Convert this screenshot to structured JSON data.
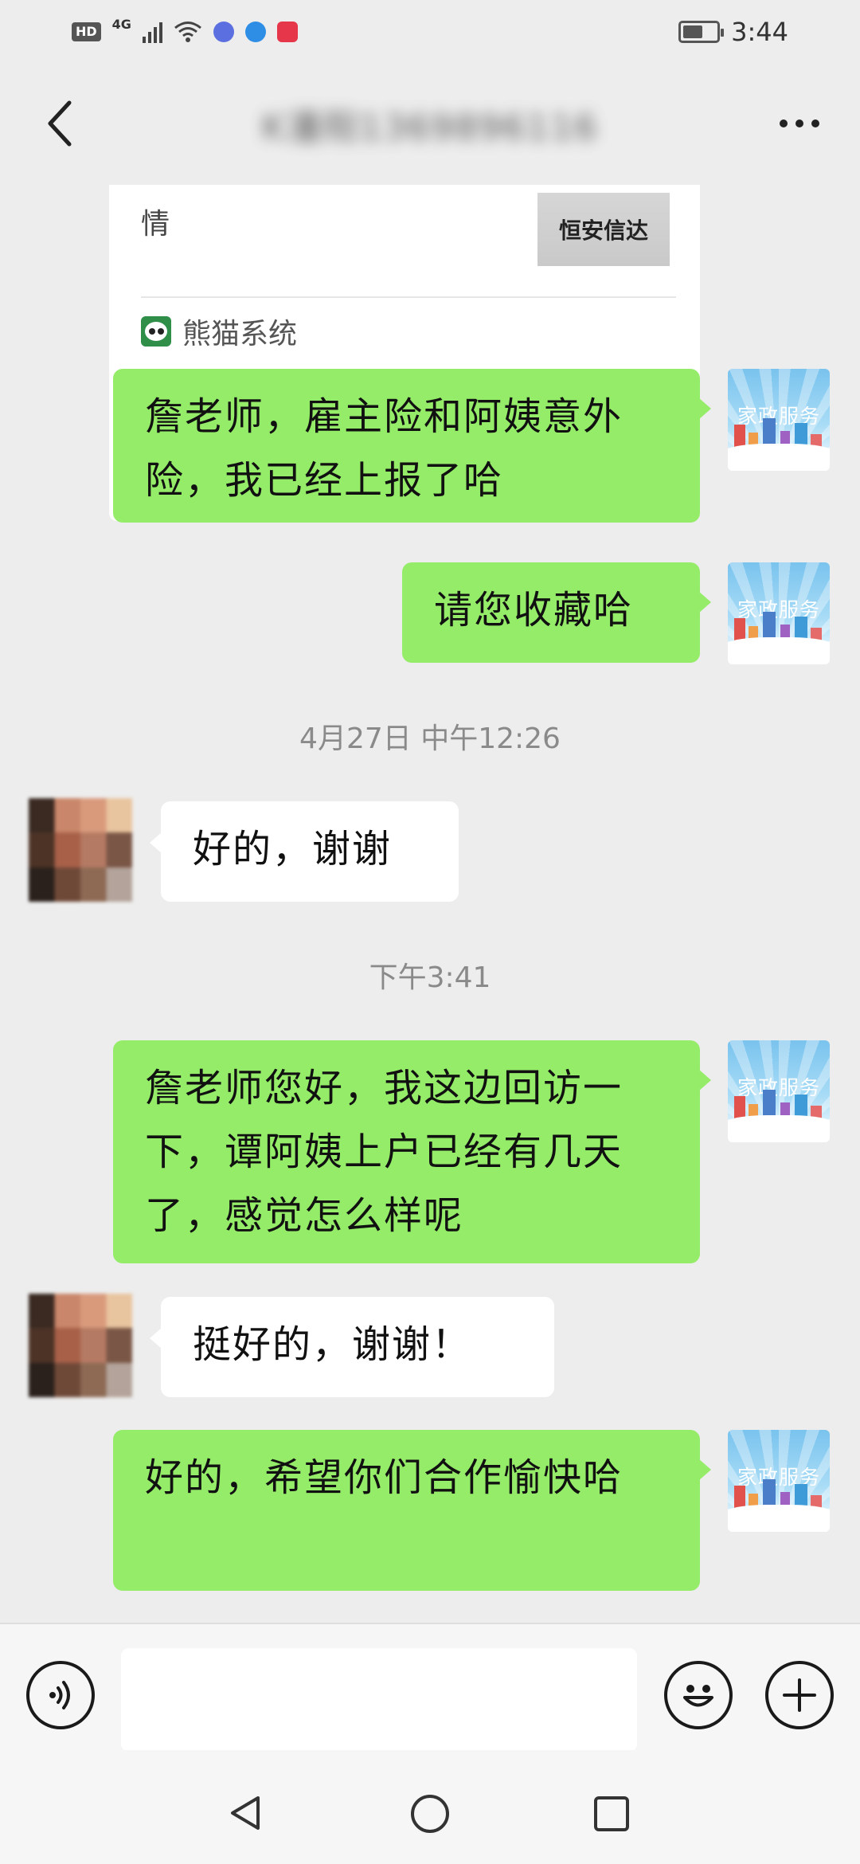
{
  "status_bar": {
    "hd": "HD",
    "network": "4G",
    "time": "3:44",
    "battery_level": 0.6
  },
  "header": {
    "title": "K潘阳1369896116"
  },
  "card": {
    "title": "情",
    "thumb_text": "恒安信达",
    "source": "熊猫系统"
  },
  "messages": {
    "m1": "詹老师，雇主险和阿姨意外险，我已经上报了哈",
    "m2": "请您收藏哈",
    "time1": "4月27日 中午12:26",
    "m3": "好的，谢谢",
    "time2": "下午3:41",
    "m4": "詹老师您好，我这边回访一下，谭阿姨上户已经有几天了，感觉怎么样呢",
    "m5": "挺好的，谢谢！",
    "m6": "好的，希望你们合作愉快哈"
  },
  "avatar": {
    "service_text": "家政服务"
  },
  "input": {
    "value": ""
  },
  "colors": {
    "background": "#ededed",
    "bubble_out": "#95ec69",
    "bubble_in": "#ffffff"
  }
}
